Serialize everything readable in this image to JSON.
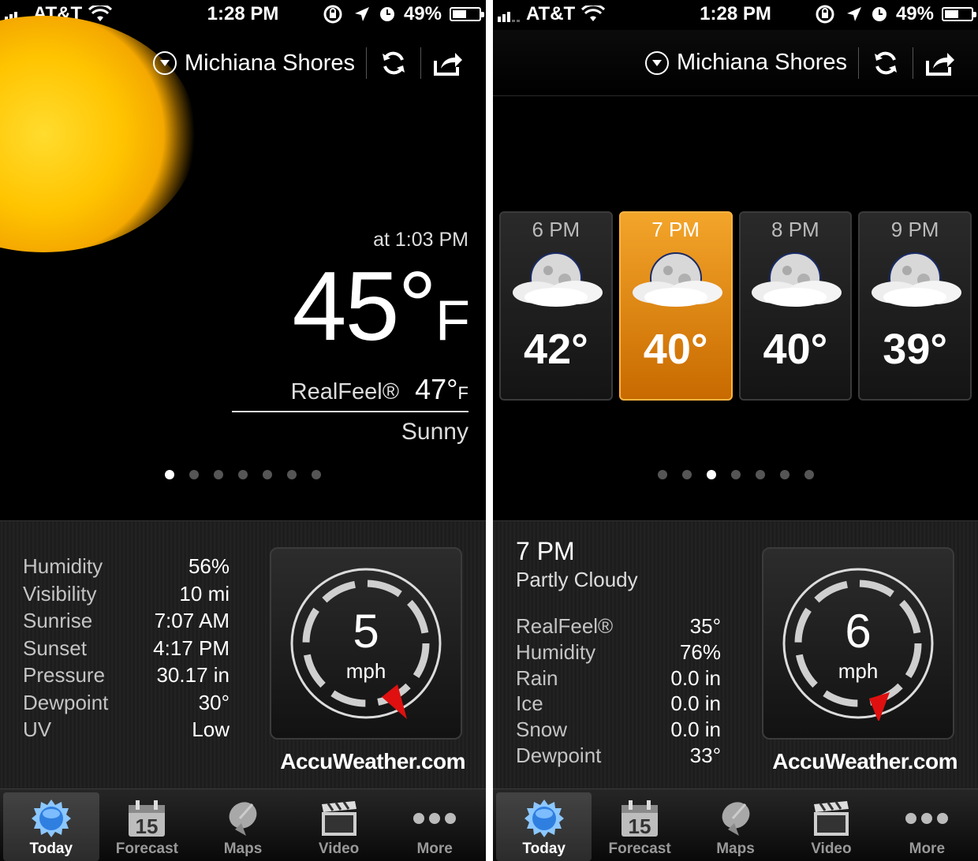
{
  "status": {
    "carrier": "AT&T",
    "time": "1:28 PM",
    "battery": "49%",
    "battery_level": 0.49
  },
  "location": {
    "name": "Michiana Shores"
  },
  "today": {
    "as_of": "at 1:03 PM",
    "temp": "45°",
    "unit": "F",
    "realfeel_label": "RealFeel®",
    "realfeel_value": "47°",
    "realfeel_unit": "F",
    "condition": "Sunny",
    "stats": [
      {
        "label": "Humidity",
        "value": "56%"
      },
      {
        "label": "Visibility",
        "value": "10 mi"
      },
      {
        "label": "Sunrise",
        "value": "7:07 AM"
      },
      {
        "label": "Sunset",
        "value": "4:17 PM"
      },
      {
        "label": "Pressure",
        "value": "30.17 in"
      },
      {
        "label": "Dewpoint",
        "value": "30°"
      },
      {
        "label": "UV",
        "value": "Low"
      }
    ],
    "wind_speed": "5",
    "wind_unit": "mph"
  },
  "hourly": {
    "hours": [
      {
        "time": "6 PM",
        "temp": "42°"
      },
      {
        "time": "7 PM",
        "temp": "40°"
      },
      {
        "time": "8 PM",
        "temp": "40°"
      },
      {
        "time": "9 PM",
        "temp": "39°"
      }
    ],
    "selected": {
      "time": "7 PM",
      "condition": "Partly Cloudy",
      "stats": [
        {
          "label": "RealFeel®",
          "value": "35°"
        },
        {
          "label": "Humidity",
          "value": "76%"
        },
        {
          "label": "Rain",
          "value": "0.0 in"
        },
        {
          "label": "Ice",
          "value": "0.0 in"
        },
        {
          "label": "Snow",
          "value": "0.0 in"
        },
        {
          "label": "Dewpoint",
          "value": "33°"
        }
      ],
      "wind_speed": "6",
      "wind_unit": "mph"
    }
  },
  "brand": "AccuWeather.com",
  "tabs": [
    {
      "label": "Today",
      "icon": "globe-icon"
    },
    {
      "label": "Forecast",
      "icon": "calendar-icon",
      "badge": "15"
    },
    {
      "label": "Maps",
      "icon": "satellite-dish-icon"
    },
    {
      "label": "Video",
      "icon": "clapperboard-icon"
    },
    {
      "label": "More",
      "icon": "more-dots-icon"
    }
  ],
  "colors": {
    "accent_orange": "#f3a52a",
    "sun_yellow": "#ffc400",
    "wind_pointer": "#e01010"
  }
}
